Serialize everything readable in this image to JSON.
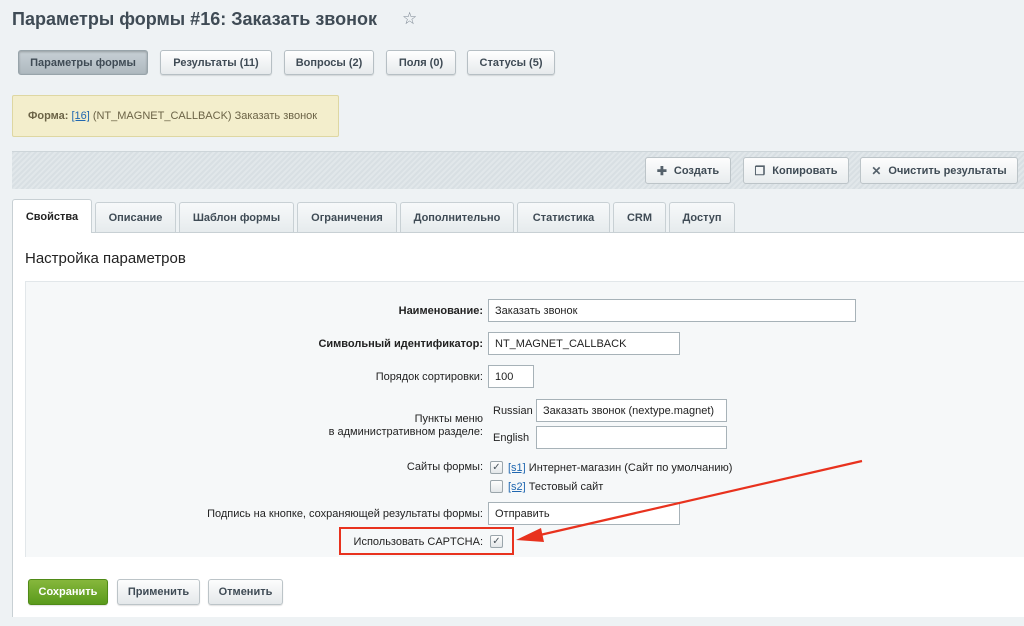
{
  "page": {
    "title": "Параметры формы #16: Заказать звонок"
  },
  "top_tabs": [
    {
      "label": "Параметры формы",
      "active": true
    },
    {
      "label": "Результаты (11)"
    },
    {
      "label": "Вопросы (2)"
    },
    {
      "label": "Поля (0)"
    },
    {
      "label": "Статусы (5)"
    }
  ],
  "notice": {
    "prefix": "Форма:",
    "link": "[16]",
    "text": "(NT_MAGNET_CALLBACK) Заказать звонок"
  },
  "toolbar": {
    "create": "Создать",
    "copy": "Копировать",
    "clear": "Очистить результаты"
  },
  "tabs": [
    {
      "label": "Свойства",
      "active": true
    },
    {
      "label": "Описание"
    },
    {
      "label": "Шаблон формы"
    },
    {
      "label": "Ограничения"
    },
    {
      "label": "Дополнительно"
    },
    {
      "label": "Статистика"
    },
    {
      "label": "CRM"
    },
    {
      "label": "Доступ"
    }
  ],
  "section": {
    "title": "Настройка параметров"
  },
  "form": {
    "name_label": "Наименование:",
    "name_value": "Заказать звонок",
    "sid_label": "Символьный идентификатор:",
    "sid_value": "NT_MAGNET_CALLBACK",
    "sort_label": "Порядок сортировки:",
    "sort_value": "100",
    "menu_label_1": "Пункты меню",
    "menu_label_2": "в административном разделе:",
    "menu_ru_lang": "Russian",
    "menu_ru_value": "Заказать звонок (nextype.magnet)",
    "menu_en_lang": "English",
    "menu_en_value": "",
    "sites_label": "Сайты формы:",
    "site1_code": "[s1]",
    "site1_name": "Интернет-магазин (Сайт по умолчанию)",
    "site1_checked": true,
    "site2_code": "[s2]",
    "site2_name": "Тестовый сайт",
    "site2_checked": false,
    "button_label": "Подпись на кнопке, сохраняющей результаты формы:",
    "button_value": "Отправить",
    "captcha_label": "Использовать CAPTCHA:",
    "captcha_checked": true
  },
  "actions": {
    "save": "Сохранить",
    "apply": "Применить",
    "cancel": "Отменить"
  },
  "colors": {
    "highlight": "#e8321e",
    "save_button": "#6aa82a",
    "link": "#2067b0"
  }
}
